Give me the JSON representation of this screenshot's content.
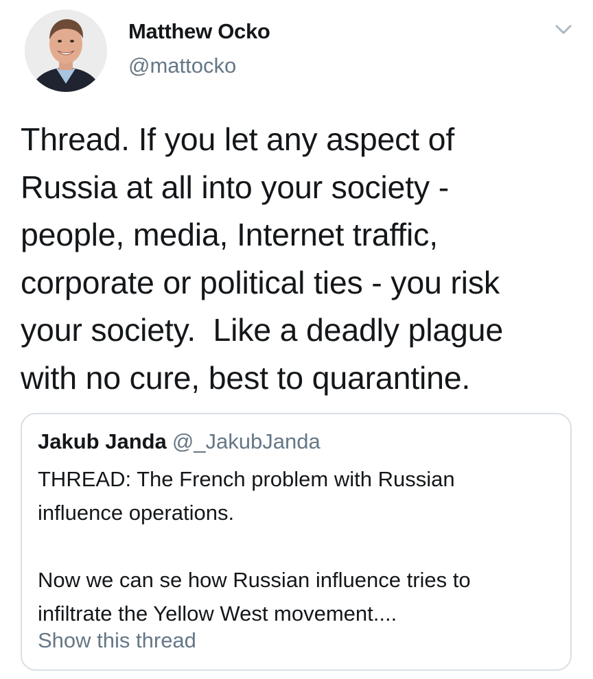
{
  "tweet": {
    "author": {
      "display_name": "Matthew Ocko",
      "handle": "@mattocko"
    },
    "text": "Thread. If you let any aspect of\nRussia at all into your society -\npeople, media, Internet traffic,\ncorporate or political ties - you risk\nyour society.  Like a deadly plague\nwith no cure, best to quarantine.",
    "menu_icon": "chevron-down-icon"
  },
  "quoted_tweet": {
    "author": {
      "display_name": "Jakub Janda",
      "handle": "@_JakubJanda"
    },
    "text": "THREAD: The French problem with Russian\ninfluence operations.\n\nNow we can se how Russian influence tries to\ninfiltrate the Yellow West movement....",
    "show_thread_label": "Show this thread"
  },
  "colors": {
    "text_primary": "#14171a",
    "text_secondary": "#657786",
    "border": "#d9dfe4"
  }
}
